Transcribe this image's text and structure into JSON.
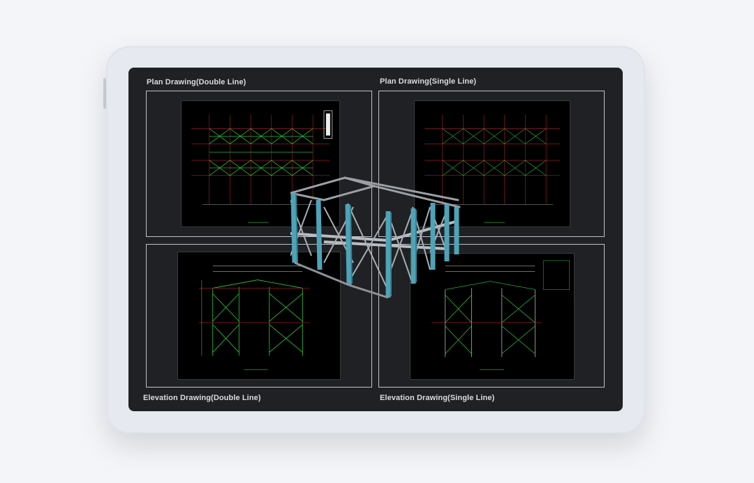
{
  "panels": {
    "plan_double": {
      "label": "Plan Drawing(Double Line)"
    },
    "plan_single": {
      "label": "Plan Drawing(Single Line)"
    },
    "elev_double": {
      "label": "Elevation Drawing(Double Line)"
    },
    "elev_single": {
      "label": "Elevation Drawing(Single Line)"
    }
  },
  "colors": {
    "screen_bg": "#1f2124",
    "cad_bg": "#000000",
    "cad_green": "#2ecc40",
    "cad_red": "#b0202a",
    "column_cyan": "#4fa3b8",
    "steel_grey": "#b8bdc2"
  }
}
